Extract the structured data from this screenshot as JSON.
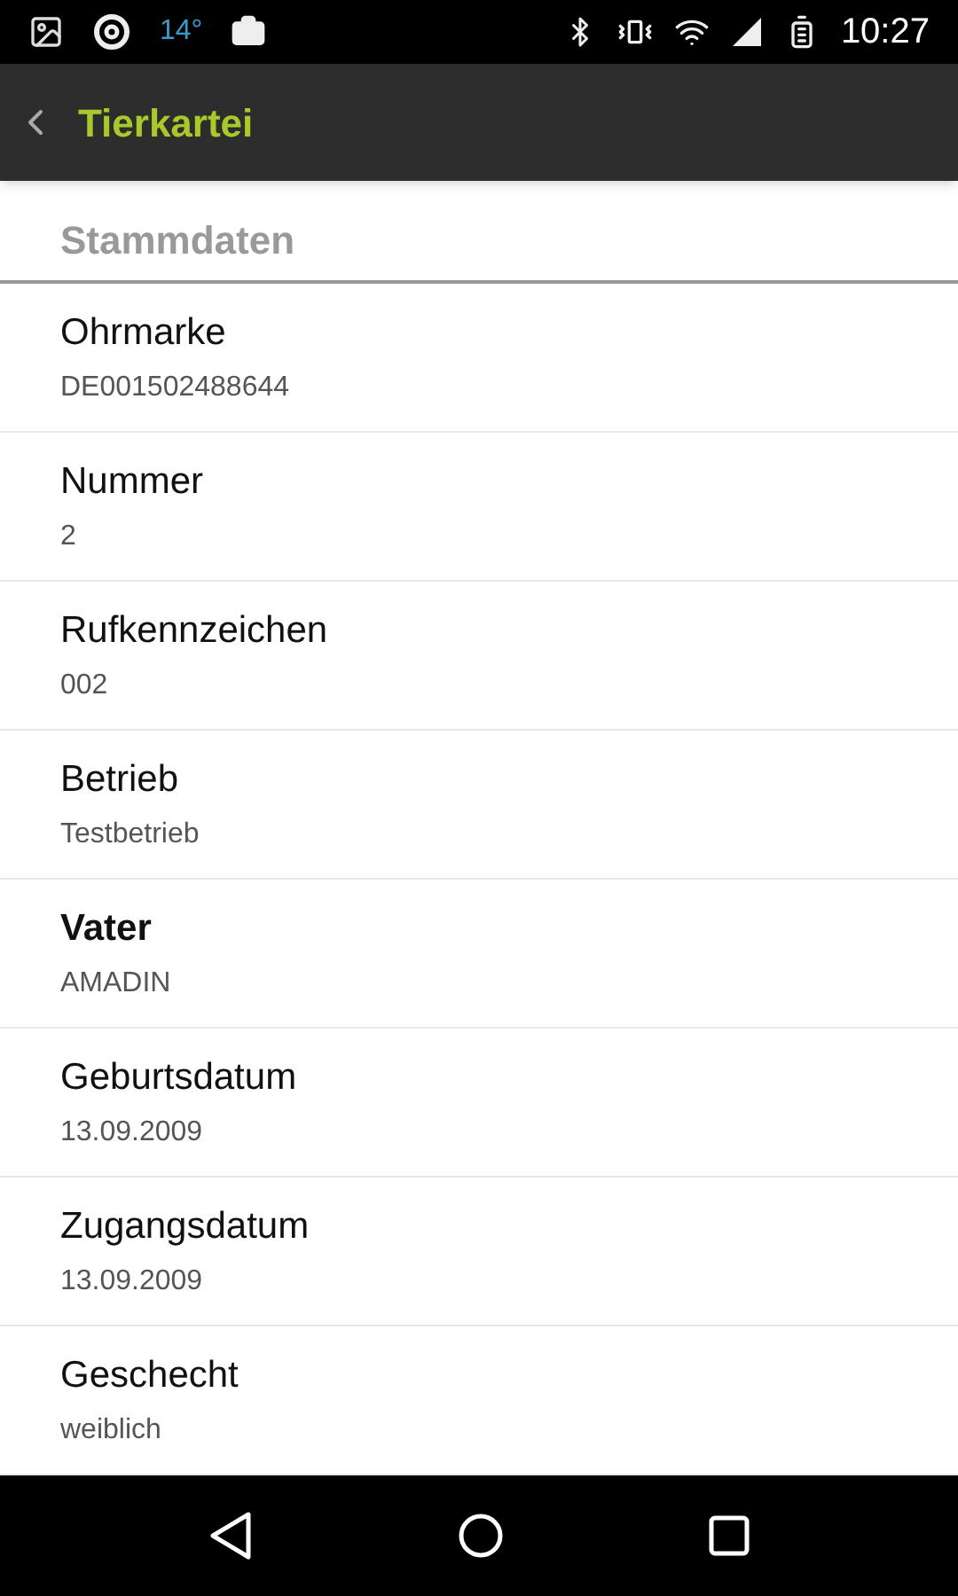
{
  "status_bar": {
    "temperature": "14°",
    "time": "10:27"
  },
  "app_bar": {
    "title": "Tierkartei"
  },
  "section": {
    "title": "Stammdaten"
  },
  "fields": [
    {
      "label": "Ohrmarke",
      "value": "DE001502488644",
      "emphasized": false
    },
    {
      "label": "Nummer",
      "value": "2",
      "emphasized": false
    },
    {
      "label": "Rufkennzeichen",
      "value": "002",
      "emphasized": false
    },
    {
      "label": "Betrieb",
      "value": "Testbetrieb",
      "emphasized": false
    },
    {
      "label": "Vater",
      "value": "AMADIN",
      "emphasized": true
    },
    {
      "label": "Geburtsdatum",
      "value": "13.09.2009",
      "emphasized": false
    },
    {
      "label": "Zugangsdatum",
      "value": "13.09.2009",
      "emphasized": false
    },
    {
      "label": "Geschecht",
      "value": "weiblich",
      "emphasized": false
    }
  ]
}
